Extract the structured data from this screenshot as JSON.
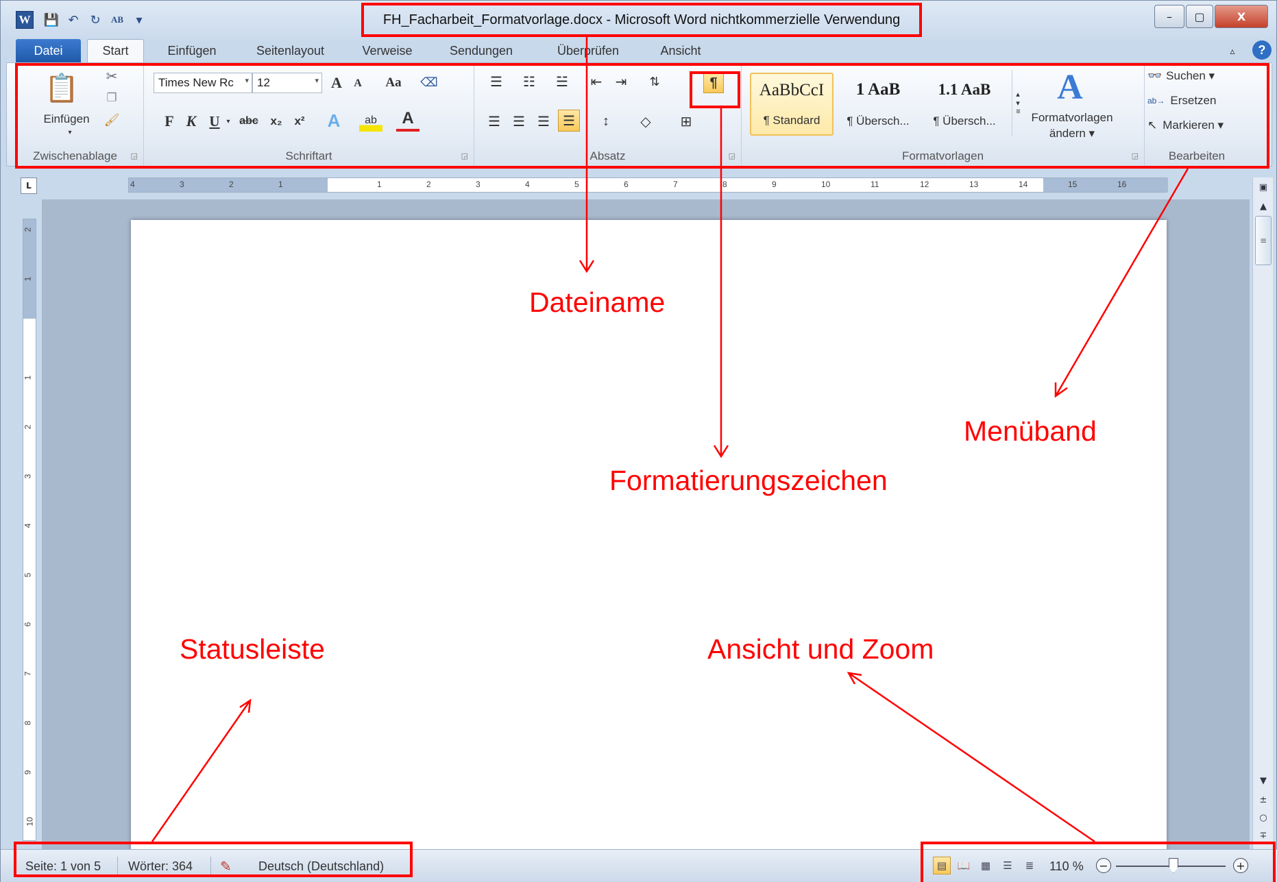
{
  "titlebar": {
    "app_letter": "W",
    "qat": {
      "save": "💾",
      "undo": "↶",
      "redo": "↻",
      "spell": "AB",
      "customize": "▾"
    },
    "title": "FH_Facharbeit_Formatvorlage.docx - Microsoft Word nichtkommerzielle Verwendung",
    "window_buttons": {
      "minimize": "–",
      "maximize": "▢",
      "close": "X"
    }
  },
  "tabs": {
    "file": "Datei",
    "start": "Start",
    "insert": "Einfügen",
    "layout": "Seitenlayout",
    "references": "Verweise",
    "mailings": "Sendungen",
    "review": "Überprüfen",
    "view": "Ansicht"
  },
  "ribbon": {
    "clipboard": {
      "label": "Zwischenablage",
      "paste": "Einfügen"
    },
    "font": {
      "label": "Schriftart",
      "font_name": "Times New Rc",
      "font_size": "12",
      "grow": "A",
      "shrink": "A",
      "case": "Aa",
      "bold": "F",
      "italic": "K",
      "underline": "U",
      "strike": "abc",
      "subscript": "x₂",
      "superscript": "x²",
      "effects": "A",
      "highlight": "ab",
      "font_color": "A"
    },
    "paragraph": {
      "label": "Absatz",
      "pilcrow": "¶"
    },
    "styles": {
      "label": "Formatvorlagen",
      "items": [
        {
          "sample": "AaBbCcI",
          "name": "¶ Standard"
        },
        {
          "sample": "1  AaB",
          "name": "¶ Übersch..."
        },
        {
          "sample": "1.1  AaB",
          "name": "¶ Übersch..."
        }
      ],
      "change_styles_line1": "Formatvorlagen",
      "change_styles_line2": "ändern ▾"
    },
    "editing": {
      "label": "Bearbeiten",
      "find": "Suchen ▾",
      "replace": "Ersetzen",
      "select": "Markieren ▾"
    }
  },
  "ruler": {
    "corner": "L",
    "h_numbers": [
      "4",
      "3",
      "2",
      "1",
      "1",
      "2",
      "3",
      "4",
      "5",
      "6",
      "7",
      "8",
      "9",
      "10",
      "11",
      "12",
      "13",
      "14",
      "15",
      "16"
    ],
    "v_numbers": [
      "2",
      "1",
      "1",
      "2",
      "3",
      "4",
      "5",
      "6",
      "7",
      "8",
      "9",
      "10"
    ]
  },
  "statusbar": {
    "page": "Seite: 1 von 5",
    "words": "Wörter: 364",
    "language": "Deutsch (Deutschland)",
    "zoom": "110 %",
    "zoom_level_percent": 110
  },
  "annotations": {
    "filename": "Dateiname",
    "ribbon": "Menüband",
    "formatting_marks": "Formatierungszeichen",
    "statusbar": "Statusleiste",
    "view_zoom": "Ansicht und Zoom"
  },
  "colors": {
    "annotation": "#ff0000",
    "file_tab": "#2b579a",
    "highlight_active": "#f9c95a"
  }
}
